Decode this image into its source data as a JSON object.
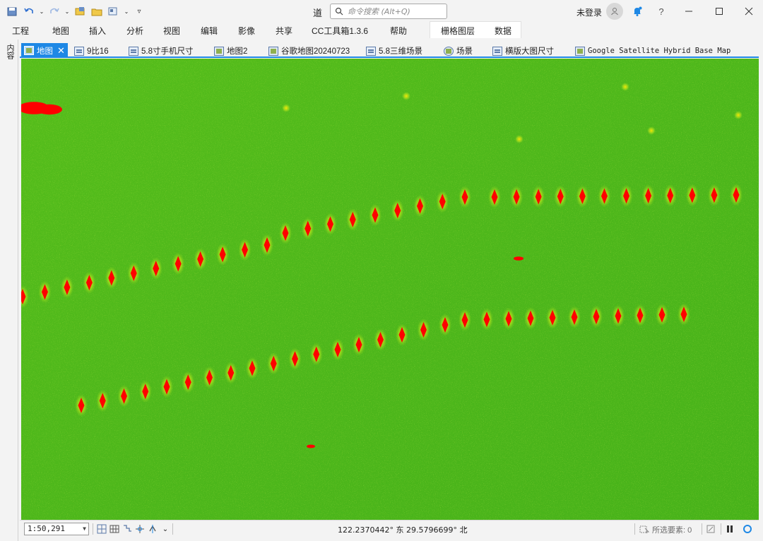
{
  "window": {
    "title": "道",
    "search_placeholder": "命令搜索 (Alt+Q)",
    "login_label": "未登录"
  },
  "menu": {
    "items": [
      "工程",
      "地图",
      "插入",
      "分析",
      "视图",
      "编辑",
      "影像",
      "共享",
      "CC工具箱1.3.6",
      "帮助",
      "栅格图层",
      "数据"
    ],
    "active": "栅格图层"
  },
  "side_panel": {
    "label": "内容"
  },
  "tabs": [
    {
      "label": "地图",
      "icon": "map-icon",
      "active": true
    },
    {
      "label": "9比16",
      "icon": "layout-icon",
      "active": false
    },
    {
      "label": "5.8寸手机尺寸",
      "icon": "layout-icon",
      "active": false
    },
    {
      "label": "地图2",
      "icon": "map-icon",
      "active": false
    },
    {
      "label": "谷歌地图20240723",
      "icon": "map-icon",
      "active": false
    },
    {
      "label": "5.8三维场景",
      "icon": "layout-icon",
      "active": false
    },
    {
      "label": "场景",
      "icon": "globe-icon",
      "active": false
    },
    {
      "label": "横版大图尺寸",
      "icon": "layout-icon",
      "active": false
    },
    {
      "label": "Google Satellite Hybrid Base Map",
      "icon": "map-icon",
      "active": false
    }
  ],
  "status": {
    "scale": "1:50,291",
    "coordinates": "122.2370442° 东 29.5796699° 北",
    "selected_label": "所选要素:",
    "selected_count": "0"
  },
  "colors": {
    "accent": "#1e88e5",
    "raster_background": "#4cb81c",
    "raster_hot": "#ff0000",
    "raster_warm": "#ffd400"
  }
}
